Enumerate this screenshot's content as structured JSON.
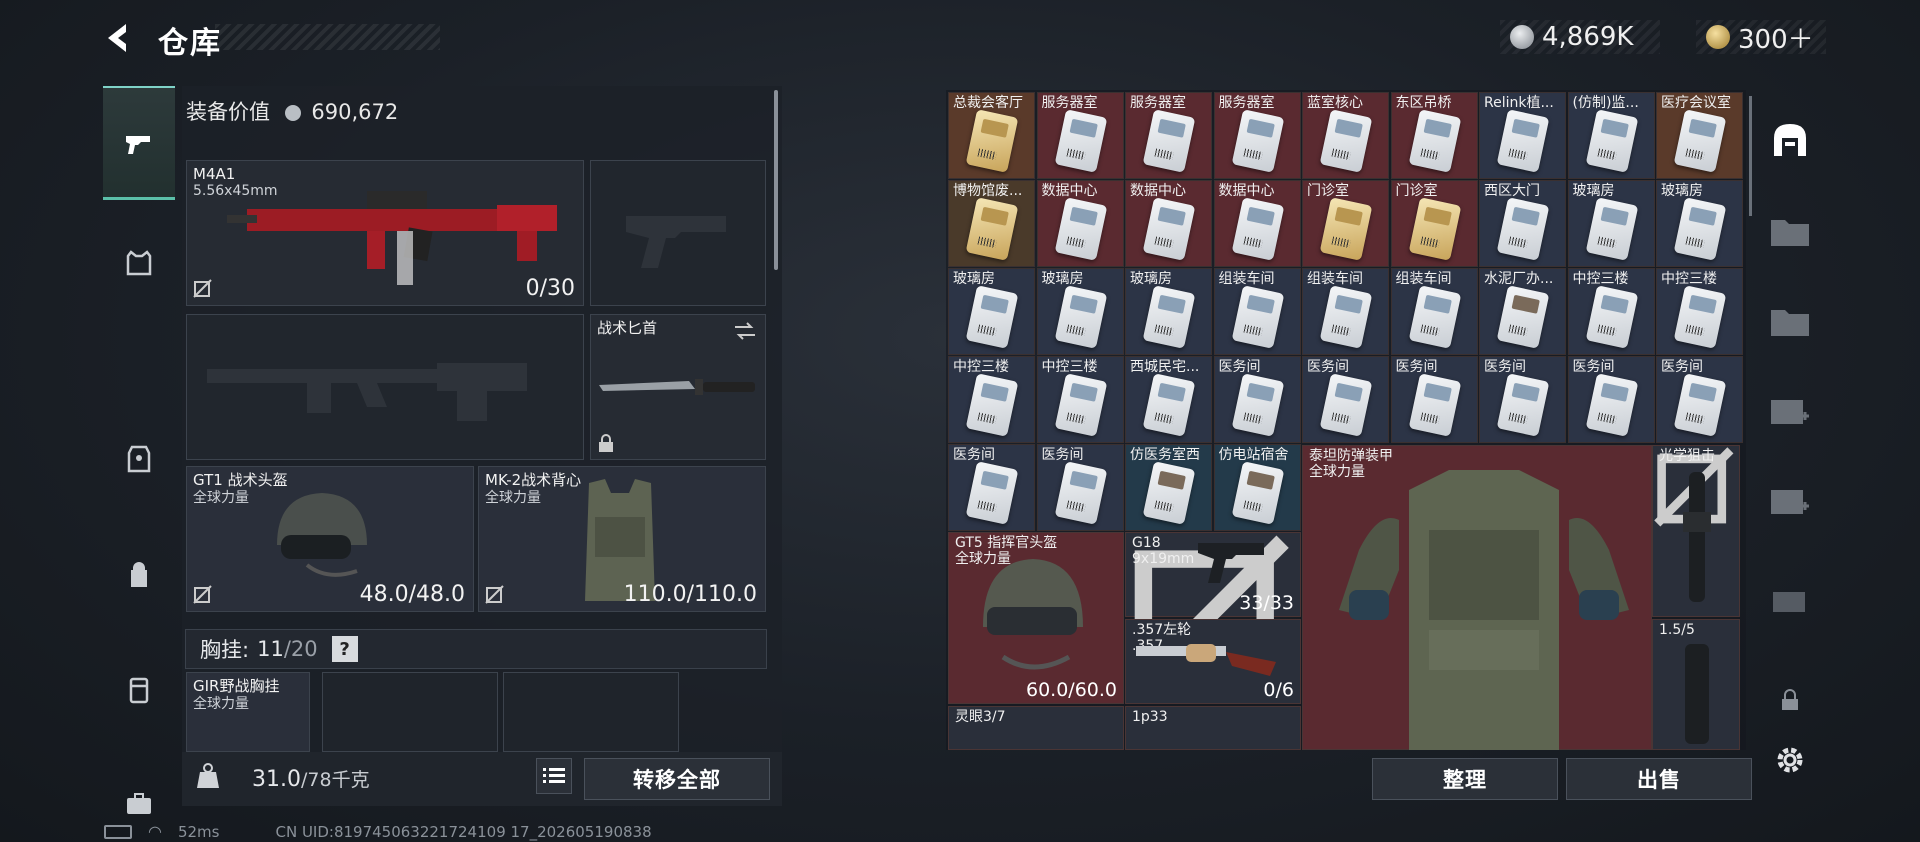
{
  "header": {
    "title": "仓库"
  },
  "currency": [
    {
      "name": "silver-coin-icon",
      "value": "4,869K",
      "color": "#c0c4c9"
    },
    {
      "name": "gold-coin-icon",
      "value": "300＋",
      "color": "#d9b860"
    }
  ],
  "left_panel": {
    "equip_value_label": "装备价值",
    "equip_value": "690,672",
    "primary": {
      "name": "M4A1",
      "caliber": "5.56x45mm",
      "ammo": "0/30"
    },
    "knife": {
      "name": "战术匕首"
    },
    "helmet": {
      "name": "GT1 战术头盔",
      "faction": "全球力量",
      "durability": "48.0/48.0"
    },
    "armor": {
      "name": "MK-2战术背心",
      "faction": "全球力量",
      "durability": "110.0/110.0"
    },
    "chest_rig": {
      "label": "胸挂:",
      "used": "11",
      "total": "/20",
      "help": "?"
    },
    "rig_item": {
      "name": "GIR野战胸挂",
      "faction": "全球力量"
    },
    "weight": {
      "current": "31.0",
      "max": "/78千克"
    },
    "transfer_all": "转移全部"
  },
  "grid_items": [
    [
      "总裁会客厅",
      "服务器室",
      "服务器室",
      "服务器室",
      "蓝室核心",
      "东区吊桥",
      "Relink植...",
      "(仿制)监...",
      "医疗会议室"
    ],
    [
      "博物馆废...",
      "数据中心",
      "数据中心",
      "数据中心",
      "门诊室",
      "门诊室",
      "西区大门",
      "玻璃房",
      "玻璃房"
    ],
    [
      "玻璃房",
      "玻璃房",
      "玻璃房",
      "组装车间",
      "组装车间",
      "组装车间",
      "水泥厂办...",
      "中控三楼",
      "中控三楼"
    ],
    [
      "中控三楼",
      "中控三楼",
      "西城民宅...",
      "医务间",
      "医务间",
      "医务间",
      "医务间",
      "医务间",
      "医务间"
    ],
    [
      "医务间",
      "医务间",
      "仿医务室西",
      "仿电站宿舍"
    ]
  ],
  "big_items": {
    "titan_armor": {
      "name": "泰坦防弹装甲",
      "faction": "全球力量"
    },
    "scope": {
      "name": "光学狙击"
    },
    "gt5": {
      "name": "GT5 指挥官头盔",
      "faction": "全球力量",
      "durability": "60.0/60.0"
    },
    "g18": {
      "name": "G18",
      "caliber": "9x19mm",
      "ammo": "33/33"
    },
    "revolver": {
      "name": ".357左轮",
      "caliber": ".357",
      "ammo": "0/6"
    },
    "scope2": {
      "name": "1.5/5"
    },
    "lingyan": {
      "name": "灵眼3/7"
    },
    "p33": {
      "name": "1p33"
    }
  },
  "actions": {
    "sort": "整理",
    "sell": "出售"
  },
  "status": {
    "ping": "52ms",
    "uid": "CN UID:819745063221724109 17_202605190838"
  }
}
